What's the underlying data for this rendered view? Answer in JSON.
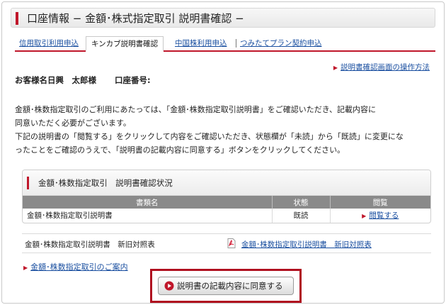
{
  "page": {
    "title": "口座情報 − 金額･株式指定取引 説明書確認 −"
  },
  "tabs": [
    {
      "label": "信用取引利用申込",
      "active": false
    },
    {
      "label": "キンカブ説明書確認",
      "active": true
    },
    {
      "label": "中国株利用申込",
      "active": false
    },
    {
      "label": "つみたてプラン契約申込",
      "active": false
    }
  ],
  "help_link": "説明書確認画面の操作方法",
  "customer": {
    "label": "お客様名",
    "name": "日興　太郎様",
    "account_label": "口座番号:"
  },
  "intro": [
    "金額･株数指定取引のご利用にあたっては、「金額･株数指定取引説明書」をご確認いただき、記載内容に",
    "同意いただく必要がございます。",
    "下記の説明書の「閲覧する」をクリックして内容をご確認いただき、状態欄が「未読」から「既読」に変更にな",
    "ったことをご確認のうえで、「説明書の記載内容に同意する」ボタンをクリックしてください。"
  ],
  "status_panel": {
    "title": "金額･株数指定取引　説明書確認状況",
    "columns": [
      "書類名",
      "状態",
      "閲覧"
    ],
    "rows": [
      {
        "name": "金額･株数指定取引説明書",
        "status": "既読",
        "action": "閲覧する"
      }
    ]
  },
  "compare": {
    "label": "金額･株数指定取引説明書　新旧対照表",
    "link": "金額･株数指定取引説明書　新旧対照表"
  },
  "guide_link": "金額･株数指定取引のご案内",
  "agree_button": "説明書の記載内容に同意する",
  "colors": {
    "accent": "#c0172b",
    "link": "#1a4fa0",
    "table_header": "#8a8a8a"
  }
}
